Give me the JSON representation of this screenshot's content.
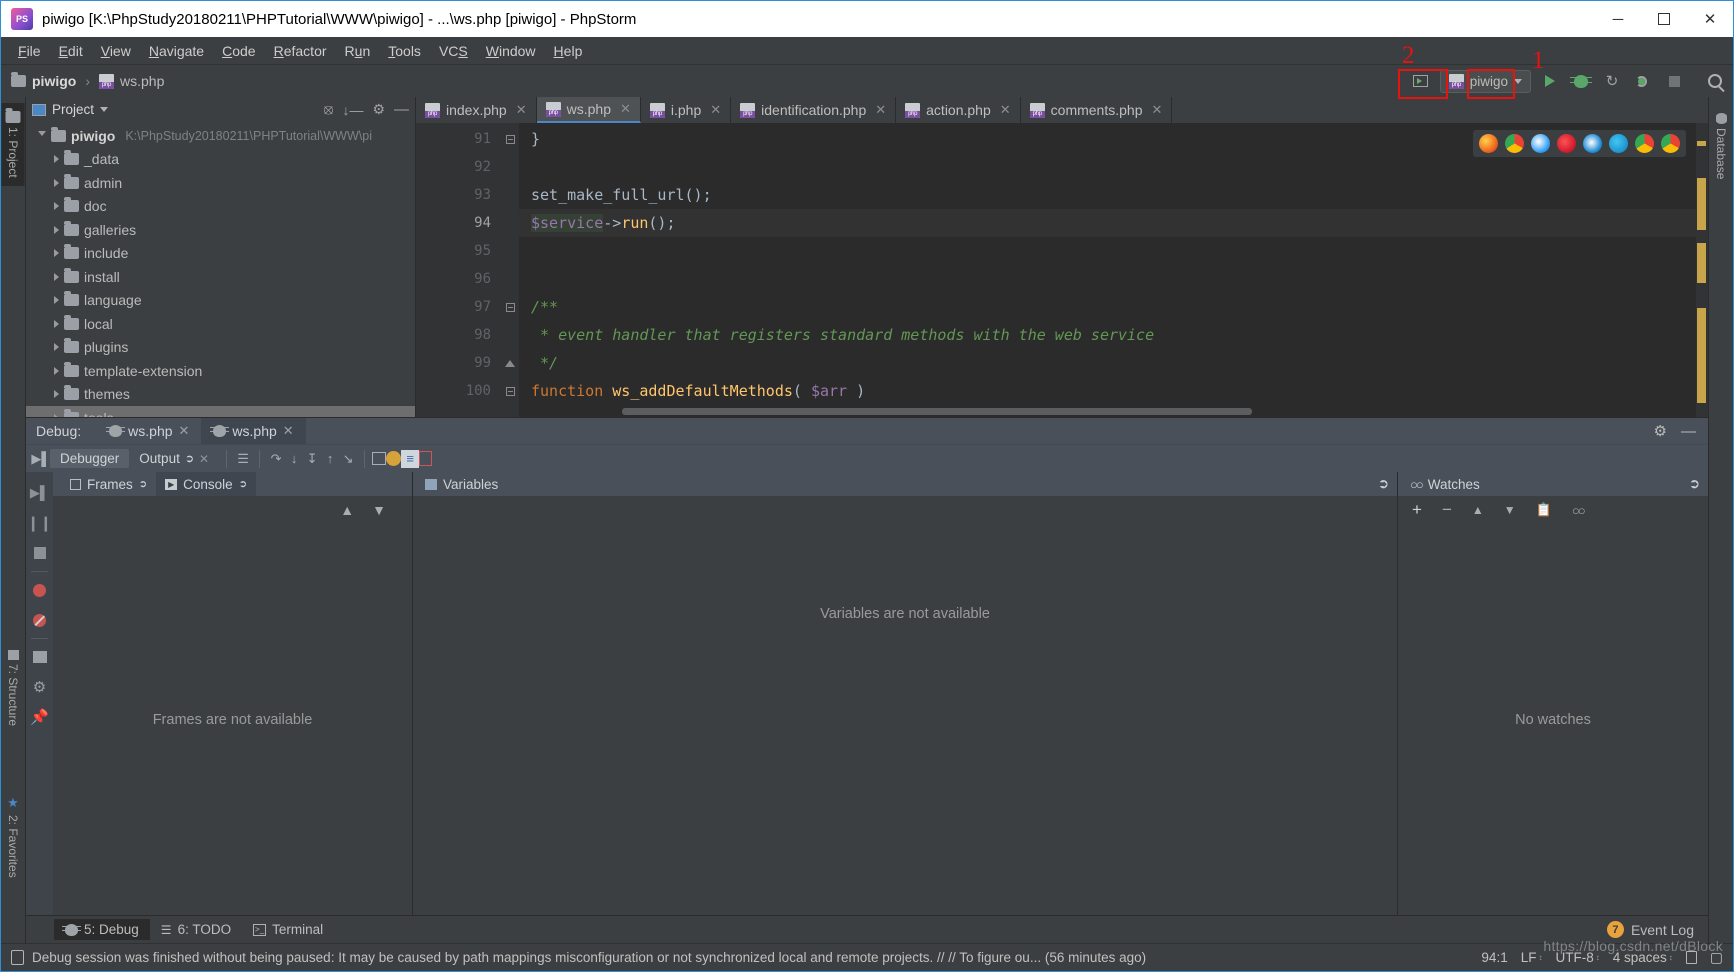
{
  "window": {
    "title": "piwigo [K:\\PhpStudy20180211\\PHPTutorial\\WWW\\piwigo] - ...\\ws.php [piwigo] - PhpStorm",
    "minimize": "─",
    "maximize": "☐",
    "close": "✕"
  },
  "menubar": [
    {
      "label": "File",
      "mnemonic": "F"
    },
    {
      "label": "Edit",
      "mnemonic": "E"
    },
    {
      "label": "View",
      "mnemonic": "V"
    },
    {
      "label": "Navigate",
      "mnemonic": "N"
    },
    {
      "label": "Code",
      "mnemonic": "C"
    },
    {
      "label": "Refactor",
      "mnemonic": "R"
    },
    {
      "label": "Run",
      "mnemonic": "u"
    },
    {
      "label": "Tools",
      "mnemonic": "T"
    },
    {
      "label": "VCS",
      "mnemonic": "S"
    },
    {
      "label": "Window",
      "mnemonic": "W"
    },
    {
      "label": "Help",
      "mnemonic": "H"
    }
  ],
  "navbar": {
    "breadcrumb": [
      "piwigo",
      "ws.php"
    ],
    "separator": "›",
    "run_config": "piwigo",
    "annotations": [
      {
        "id": "2",
        "target": "debug-button"
      },
      {
        "id": "1",
        "target": "listen-php-debug-button"
      }
    ]
  },
  "project_panel": {
    "title": "Project",
    "root": {
      "name": "piwigo",
      "path": "K:\\PhpStudy20180211\\PHPTutorial\\WWW\\pi"
    },
    "items": [
      {
        "label": "_data",
        "selected": false
      },
      {
        "label": "admin",
        "selected": false
      },
      {
        "label": "doc",
        "selected": false
      },
      {
        "label": "galleries",
        "selected": false
      },
      {
        "label": "include",
        "selected": false
      },
      {
        "label": "install",
        "selected": false
      },
      {
        "label": "language",
        "selected": false
      },
      {
        "label": "local",
        "selected": false
      },
      {
        "label": "plugins",
        "selected": false
      },
      {
        "label": "template-extension",
        "selected": false
      },
      {
        "label": "themes",
        "selected": false
      },
      {
        "label": "tools",
        "selected": true
      }
    ]
  },
  "editor": {
    "tabs": [
      {
        "label": "index.php",
        "active": false
      },
      {
        "label": "ws.php",
        "active": true
      },
      {
        "label": "i.php",
        "active": false
      },
      {
        "label": "identification.php",
        "active": false
      },
      {
        "label": "action.php",
        "active": false
      },
      {
        "label": "comments.php",
        "active": false
      }
    ],
    "lines": [
      {
        "num": "91",
        "current": false,
        "fold": "end",
        "tokens": [
          {
            "t": "}",
            "c": "punc"
          }
        ]
      },
      {
        "num": "92",
        "current": false,
        "fold": "",
        "tokens": []
      },
      {
        "num": "93",
        "current": false,
        "fold": "",
        "tokens": [
          {
            "t": "set_make_full_url",
            "c": "punc"
          },
          {
            "t": "();",
            "c": "punc"
          }
        ]
      },
      {
        "num": "94",
        "current": true,
        "fold": "",
        "tokens": [
          {
            "t": "$service",
            "c": "var varhl"
          },
          {
            "t": "->",
            "c": "punc"
          },
          {
            "t": "run",
            "c": "fn"
          },
          {
            "t": "();",
            "c": "punc"
          }
        ]
      },
      {
        "num": "95",
        "current": false,
        "fold": "",
        "tokens": []
      },
      {
        "num": "96",
        "current": false,
        "fold": "",
        "tokens": []
      },
      {
        "num": "97",
        "current": false,
        "fold": "start",
        "tokens": [
          {
            "t": "/**",
            "c": "cmt"
          }
        ]
      },
      {
        "num": "98",
        "current": false,
        "fold": "",
        "tokens": [
          {
            "t": " * event handler that registers standard methods with the web service",
            "c": "cmt"
          }
        ]
      },
      {
        "num": "99",
        "current": false,
        "fold": "close",
        "tokens": [
          {
            "t": " */",
            "c": "cmt"
          }
        ]
      },
      {
        "num": "100",
        "current": false,
        "fold": "start",
        "tokens": [
          {
            "t": "function",
            "c": "kw"
          },
          {
            "t": " ws_addDefaultMethods",
            "c": "fn"
          },
          {
            "t": "( ",
            "c": "punc"
          },
          {
            "t": "$arr",
            "c": "var"
          },
          {
            "t": " )",
            "c": "punc"
          }
        ]
      }
    ]
  },
  "debug_window": {
    "label": "Debug:",
    "session_tabs": [
      {
        "label": "ws.php",
        "active": false
      },
      {
        "label": "ws.php",
        "active": true
      }
    ],
    "toolbar_tabs": [
      {
        "label": "Debugger",
        "active": true
      },
      {
        "label": "Output",
        "active": false
      }
    ],
    "frames": {
      "tabs": [
        {
          "label": "Frames",
          "active": false
        },
        {
          "label": "Console",
          "active": true
        }
      ],
      "empty_message": "Frames are not available"
    },
    "variables": {
      "title": "Variables",
      "empty_message": "Variables are not available"
    },
    "watches": {
      "title": "Watches",
      "empty_message": "No watches"
    }
  },
  "left_rail": [
    {
      "label": "1: Project",
      "active": true
    },
    {
      "label": "7: Structure",
      "active": false
    },
    {
      "label": "2: Favorites",
      "active": false
    }
  ],
  "right_rail": [
    {
      "label": "Database",
      "active": false
    }
  ],
  "bottom_tabs": [
    {
      "label": "5: Debug",
      "mnemonic": "5",
      "active": true
    },
    {
      "label": "6: TODO",
      "mnemonic": "6",
      "active": false
    },
    {
      "label": "Terminal",
      "mnemonic": "",
      "active": false
    }
  ],
  "event_log": {
    "count": "7",
    "label": "Event Log"
  },
  "statusbar": {
    "message": "Debug session was finished without being paused: It may be caused by path mappings misconfiguration or not synchronized local and remote projects. // // To figure ou... (56 minutes ago)",
    "caret": "94:1",
    "line_ending": "LF",
    "encoding": "UTF-8",
    "indent": "4 spaces",
    "watermark": "https://blog.csdn.net/dBlock"
  },
  "colors": {
    "accent_blue": "#4a88c7",
    "run_green": "#59a869",
    "annotation_red": "#e8120e",
    "badge_orange": "#e8a33d",
    "editor_bg": "#2b2b2b",
    "panel_bg": "#3c3f41",
    "debug_header": "#4a5059"
  }
}
